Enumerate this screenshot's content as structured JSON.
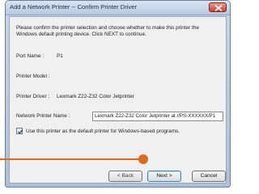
{
  "window": {
    "title": "Add a Network Printer -- Confirm Printer Driver"
  },
  "intro": {
    "line1": "Please confirm the printer selection and choose whether to make this printer the",
    "line2": "Windows default printing device. Click NEXT to continue."
  },
  "fields": {
    "port_name_label": "Port Name :",
    "port_name_value": "P1",
    "printer_model_label": "Printer Model :",
    "printer_driver_label": "Printer Driver :",
    "printer_driver_value": "Lexmark Z22-Z32 Color Jetprinter",
    "network_printer_name_label": "Network Printer Name :",
    "network_printer_name_value": "Lexmark Z22-Z32 Color Jetprinter at //PS-XXXXXX/P1"
  },
  "default_printer": {
    "checked": true,
    "label": "Use this printer as the default printer for Windows-based programs."
  },
  "buttons": {
    "back": "< Back",
    "next": "Next >",
    "cancel": "Cancel"
  },
  "colors": {
    "pointer": "#e06a1a",
    "close_button": "#c8432c"
  }
}
